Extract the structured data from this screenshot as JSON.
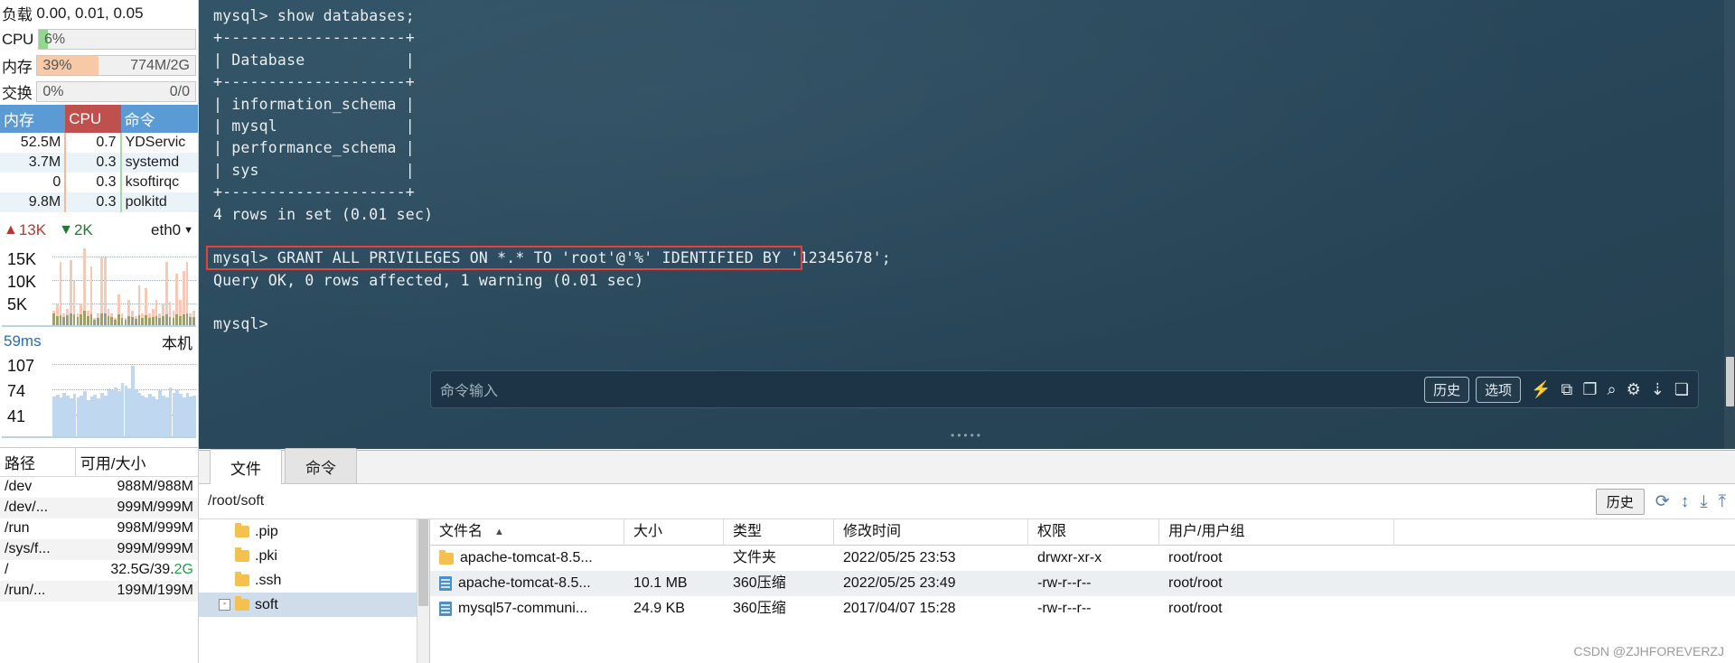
{
  "sidebar": {
    "load": {
      "label": "负载",
      "values": "0.00, 0.01, 0.05"
    },
    "cpu": {
      "label": "CPU",
      "percent_text": "6%",
      "percent": 6,
      "fill_color": "#8ed98e"
    },
    "memory": {
      "label": "内存",
      "percent_text": "39%",
      "percent": 39,
      "detail": "774M/2G",
      "fill_color": "#f7c9a6"
    },
    "swap": {
      "label": "交换",
      "percent_text": "0%",
      "percent": 0,
      "detail": "0/0",
      "fill_color": "#cfe3f5"
    },
    "process_table": {
      "headers": [
        "内存",
        "CPU",
        "命令"
      ],
      "rows": [
        {
          "mem": "52.5M",
          "cpu": "0.7",
          "cmd": "YDServic"
        },
        {
          "mem": "3.7M",
          "cpu": "0.3",
          "cmd": "systemd"
        },
        {
          "mem": "0",
          "cpu": "0.3",
          "cmd": "ksoftirqc"
        },
        {
          "mem": "9.8M",
          "cpu": "0.3",
          "cmd": "polkitd"
        }
      ]
    },
    "network": {
      "upload": "13K",
      "download": "2K",
      "interface": "eth0",
      "axis_labels": [
        "15K",
        "10K",
        "5K"
      ]
    },
    "latency": {
      "value": "59ms",
      "target": "本机",
      "axis_labels": [
        "107",
        "74",
        "41"
      ]
    },
    "disk_table": {
      "headers": [
        "路径",
        "可用/大小"
      ],
      "rows": [
        {
          "path": "/dev",
          "avail": "988M/988M"
        },
        {
          "path": "/dev/...",
          "avail": "999M/999M"
        },
        {
          "path": "/run",
          "avail": "998M/999M"
        },
        {
          "path": "/sys/f...",
          "avail": "999M/999M"
        },
        {
          "path": "/",
          "avail": "32.5G/39.2G",
          "highlight_tail": "2G"
        },
        {
          "path": "/run/...",
          "avail": "199M/199M"
        }
      ]
    }
  },
  "terminal": {
    "lines": [
      "mysql> show databases;",
      "+--------------------+",
      "| Database           |",
      "+--------------------+",
      "| information_schema |",
      "| mysql              |",
      "| performance_schema |",
      "| sys                |",
      "+--------------------+",
      "4 rows in set (0.01 sec)",
      ""
    ],
    "grant_line": "mysql> GRANT ALL PRIVILEGES ON *.* TO 'root'@'%' IDENTIFIED BY '12345678';",
    "after_lines": [
      "Query OK, 0 rows affected, 1 warning (0.01 sec)",
      "",
      "mysql>"
    ],
    "highlight_color": "#e8403a"
  },
  "command_bar": {
    "placeholder": "命令输入",
    "buttons": [
      {
        "label": "历史",
        "name": "history-button"
      },
      {
        "label": "选项",
        "name": "options-button"
      }
    ],
    "icons": [
      {
        "name": "bolt-icon",
        "glyph": "⚡"
      },
      {
        "name": "copy-icon",
        "glyph": "⧉"
      },
      {
        "name": "paste-icon",
        "glyph": "❐"
      },
      {
        "name": "search-icon",
        "glyph": "⌕"
      },
      {
        "name": "gear-icon",
        "glyph": "⚙"
      },
      {
        "name": "download-icon",
        "glyph": "⇣"
      },
      {
        "name": "window-icon",
        "glyph": "❏"
      }
    ]
  },
  "file_panel": {
    "tabs": [
      {
        "label": "文件",
        "active": true
      },
      {
        "label": "命令",
        "active": false
      }
    ],
    "path": "/root/soft",
    "toolbar": {
      "history_label": "历史",
      "icons": [
        {
          "name": "refresh-icon",
          "glyph": "⟳"
        },
        {
          "name": "sort-updown-icon",
          "glyph": "↕"
        },
        {
          "name": "download-icon",
          "glyph": "⤓"
        },
        {
          "name": "upload-icon",
          "glyph": "⤒"
        }
      ]
    },
    "tree": [
      {
        "label": ".pip",
        "selected": false,
        "expandable": false
      },
      {
        "label": ".pki",
        "selected": false,
        "expandable": false
      },
      {
        "label": ".ssh",
        "selected": false,
        "expandable": false
      },
      {
        "label": "soft",
        "selected": true,
        "expandable": true,
        "expander": "-"
      }
    ],
    "list": {
      "headers": [
        "文件名",
        "大小",
        "类型",
        "修改时间",
        "权限",
        "用户/用户组"
      ],
      "sorted_column": "文件名",
      "rows": [
        {
          "name": "apache-tomcat-8.5...",
          "icon": "folder-icon",
          "size": "",
          "type": "文件夹",
          "time": "2022/05/25 23:53",
          "perm": "drwxr-xr-x",
          "owner": "root/root"
        },
        {
          "name": "apache-tomcat-8.5...",
          "icon": "archive-icon",
          "size": "10.1 MB",
          "type": "360压缩",
          "time": "2022/05/25 23:49",
          "perm": "-rw-r--r--",
          "owner": "root/root"
        },
        {
          "name": "mysql57-communi...",
          "icon": "archive-icon",
          "size": "24.9 KB",
          "type": "360压缩",
          "time": "2017/04/07 15:28",
          "perm": "-rw-r--r--",
          "owner": "root/root"
        }
      ]
    }
  },
  "watermark": "CSDN @ZJHFOREVERZJ",
  "chart_data": [
    {
      "type": "bar",
      "title": "network-traffic",
      "ylabel": "",
      "ytick_labels": [
        "15K",
        "10K",
        "5K"
      ],
      "ylim": [
        0,
        17000
      ],
      "series": [
        {
          "name": "upload",
          "color": "#f7c9b4",
          "values": [
            3000,
            4500,
            13500,
            2500,
            3500,
            14000,
            9500,
            2500,
            4500,
            16500,
            3000,
            12500,
            1500,
            2500,
            14500,
            14500,
            3500,
            2500,
            1500,
            6500,
            2500,
            1500,
            5500,
            3000,
            2000,
            8500,
            2500,
            8000,
            2500,
            3500,
            5500,
            2500,
            4500,
            13500,
            5000,
            3000,
            11000,
            5500,
            11500,
            13500,
            2500,
            3000
          ]
        },
        {
          "name": "download",
          "color": "#9f9f6d",
          "values": [
            2500,
            2000,
            2200,
            1800,
            2200,
            2600,
            2400,
            1700,
            2300,
            3000,
            2000,
            2400,
            1200,
            1500,
            2600,
            2600,
            2000,
            1800,
            1100,
            2400,
            1600,
            1100,
            2000,
            1700,
            1300,
            2200,
            1600,
            2100,
            1500,
            1800,
            2000,
            1500,
            2000,
            2400,
            1800,
            1600,
            2300,
            2000,
            2400,
            2600,
            1700,
            1800
          ]
        }
      ]
    },
    {
      "type": "bar",
      "title": "latency",
      "ytick_labels": [
        "107",
        "74",
        "41"
      ],
      "ylim": [
        0,
        120
      ],
      "values": [
        60,
        63,
        58,
        66,
        62,
        57,
        64,
        59,
        61,
        68,
        55,
        60,
        63,
        57,
        66,
        62,
        72,
        70,
        74,
        68,
        80,
        76,
        72,
        107,
        70,
        66,
        62,
        58,
        64,
        60,
        56,
        70,
        62,
        58,
        74,
        66,
        70,
        64,
        58,
        66,
        60,
        62
      ],
      "color": "#bfd8ef"
    }
  ]
}
